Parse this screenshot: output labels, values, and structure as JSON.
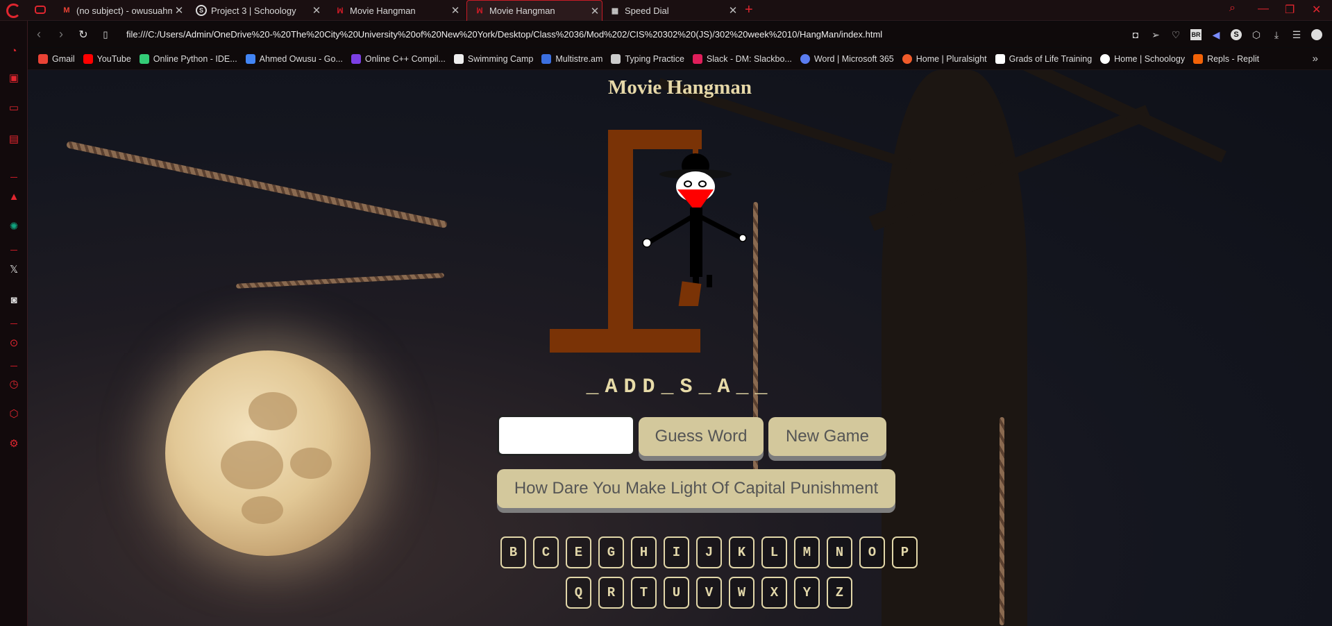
{
  "browser": {
    "tabs": [
      {
        "label": "(no subject) - owusuahmed",
        "icon": "gmail-icon",
        "active": false
      },
      {
        "label": "Project 3 | Schoology",
        "icon": "schoology-icon",
        "active": false
      },
      {
        "label": "Movie Hangman",
        "icon": "movie-icon",
        "active": false
      },
      {
        "label": "Movie Hangman",
        "icon": "movie-icon",
        "active": true
      },
      {
        "label": "Speed Dial",
        "icon": "grid-icon",
        "active": false
      }
    ],
    "url": "file:///C:/Users/Admin/OneDrive%20-%20The%20City%20University%20of%20New%20York/Desktop/Class%2036/Mod%202/CIS%20302%20(JS)/302%20week%2010/HangMan/index.html",
    "bookmarks": [
      {
        "label": "Gmail",
        "color": "#ea4335"
      },
      {
        "label": "YouTube",
        "color": "#ff0000"
      },
      {
        "label": "Online Python - IDE...",
        "color": "#3c7"
      },
      {
        "label": "Ahmed Owusu - Go...",
        "color": "#4285f4"
      },
      {
        "label": "Online C++ Compil...",
        "color": "#7b3fe4"
      },
      {
        "label": "Swimming Camp",
        "color": "#eeeeee"
      },
      {
        "label": "Multistre.am",
        "color": "#3b6fe0"
      },
      {
        "label": "Typing Practice",
        "color": "#cccccc"
      },
      {
        "label": "Slack - DM: Slackbo...",
        "color": "#e01e5a"
      },
      {
        "label": "Word | Microsoft 365",
        "color": "#5a7cf0"
      },
      {
        "label": "Home | Pluralsight",
        "color": "#f15b2a"
      },
      {
        "label": "Grads of Life Training",
        "color": "#ffffff"
      },
      {
        "label": "Home | Schoology",
        "color": "#ffffff"
      },
      {
        "label": "Repls - Replit",
        "color": "#f26207"
      }
    ]
  },
  "game": {
    "title": "Movie Hangman",
    "word_display": "_ADD_S_A__",
    "input_value": "",
    "guess_button": "Guess Word",
    "new_game_button": "New Game",
    "message_button": "How Dare You Make Light Of Capital Punishment",
    "letters_row1": [
      "B",
      "C",
      "E",
      "G",
      "H",
      "I",
      "J",
      "K",
      "L",
      "M",
      "N",
      "O",
      "P"
    ],
    "letters_row2": [
      "Q",
      "R",
      "T",
      "U",
      "V",
      "W",
      "X",
      "Y",
      "Z"
    ]
  }
}
